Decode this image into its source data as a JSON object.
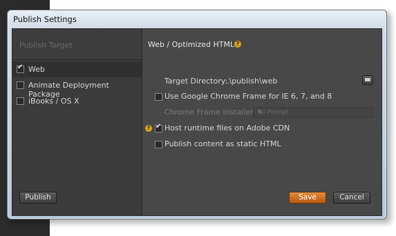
{
  "window": {
    "title": "Publish Settings"
  },
  "left_pane": {
    "header": "Publish Target",
    "targets": [
      {
        "label": "Web",
        "checked": true,
        "selected": true
      },
      {
        "label": "Animate Deployment Package",
        "checked": false,
        "selected": false
      },
      {
        "label": "iBooks / OS X",
        "checked": false,
        "selected": false
      }
    ],
    "publish_button": "Publish"
  },
  "right_pane": {
    "section_title": "Web / Optimized HTML",
    "help_glyph": "?",
    "target_directory_label": "Target Directory:",
    "target_directory_value": ".\\publish\\web",
    "chrome_frame_label": "Use Google Chrome Frame for IE 6, 7, and 8",
    "chrome_frame_checked": false,
    "chrome_installer_label": "Chrome Frame Installer:",
    "chrome_installer_value": "No Prompt",
    "host_runtime_label": "Host runtime files on Adobe CDN",
    "host_runtime_checked": true,
    "static_html_label": "Publish content as static HTML",
    "static_html_checked": false,
    "save_button": "Save",
    "cancel_button": "Cancel"
  },
  "colors": {
    "dialog_bg": "#484848",
    "left_pane_bg": "#3b3b3b",
    "primary_button": "#d0761f",
    "help_icon": "#d7a41f"
  }
}
